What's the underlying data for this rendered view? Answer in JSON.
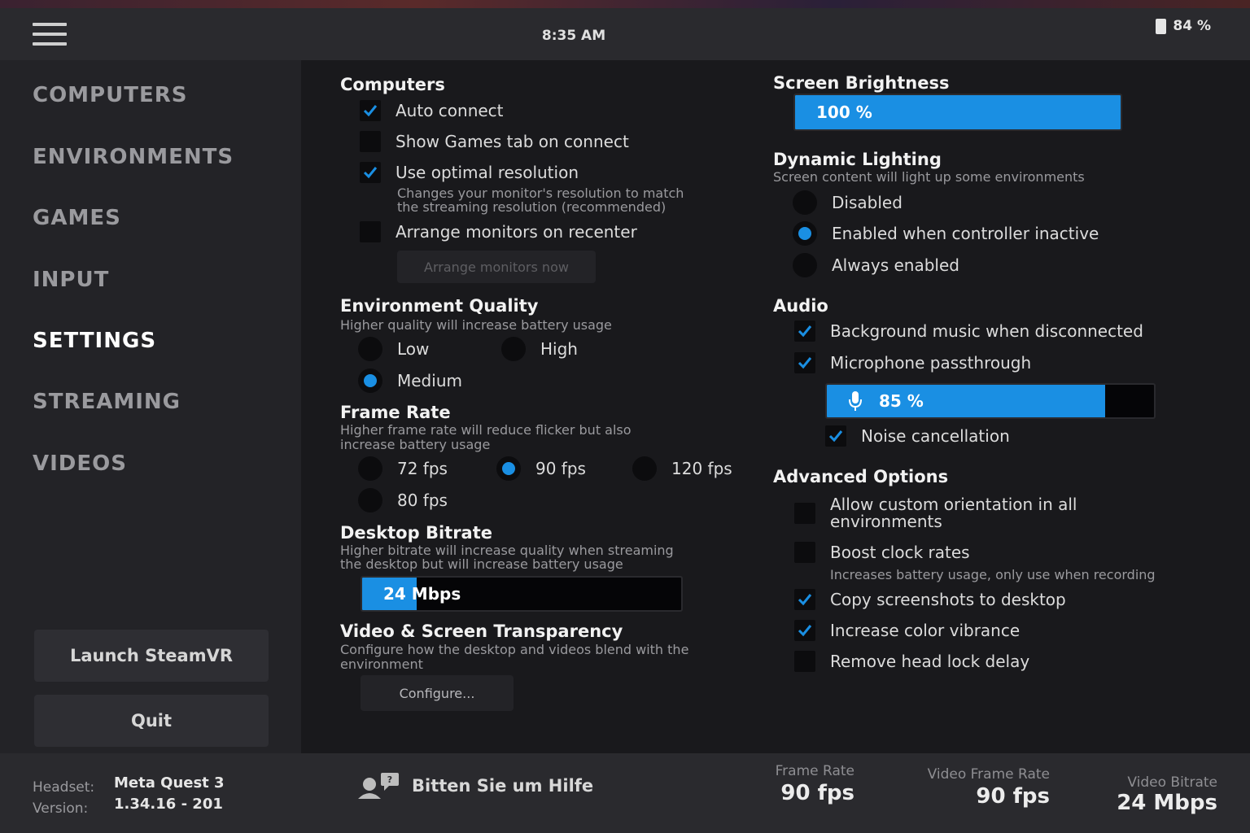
{
  "topbar": {
    "time": "8:35 AM",
    "battery": "84 %"
  },
  "sidebar": {
    "items": [
      "COMPUTERS",
      "ENVIRONMENTS",
      "GAMES",
      "INPUT",
      "SETTINGS",
      "STREAMING",
      "VIDEOS"
    ],
    "active": "SETTINGS",
    "launch_label": "Launch SteamVR",
    "quit_label": "Quit"
  },
  "computers": {
    "title": "Computers",
    "auto_connect": "Auto connect",
    "show_games": "Show Games tab on connect",
    "optimal_resolution": "Use optimal resolution",
    "optimal_desc_1": "Changes your monitor's resolution to match",
    "optimal_desc_2": "the streaming resolution (recommended)",
    "arrange_recenter": "Arrange monitors on recenter",
    "arrange_now": "Arrange monitors now"
  },
  "environment_quality": {
    "title": "Environment Quality",
    "desc": "Higher quality will increase battery usage",
    "low": "Low",
    "high": "High",
    "medium": "Medium",
    "selected": "Medium"
  },
  "frame_rate": {
    "title": "Frame Rate",
    "desc_1": "Higher frame rate will reduce flicker but also",
    "desc_2": "increase battery usage",
    "fps72": "72 fps",
    "fps90": "90 fps",
    "fps120": "120 fps",
    "fps80": "80 fps",
    "selected": "90 fps"
  },
  "desktop_bitrate": {
    "title": "Desktop Bitrate",
    "desc_1": "Higher bitrate will increase quality when streaming",
    "desc_2": "the desktop but will increase battery usage",
    "value": "24 Mbps",
    "fill_fraction": 0.17
  },
  "transparency": {
    "title": "Video & Screen Transparency",
    "desc_1": "Configure how the desktop and videos blend with the",
    "desc_2": "environment",
    "configure": "Configure..."
  },
  "brightness": {
    "title": "Screen Brightness",
    "value": "100 %",
    "fill_fraction": 1.0
  },
  "dynamic_lighting": {
    "title": "Dynamic Lighting",
    "desc": "Screen content will light up some environments",
    "disabled": "Disabled",
    "inactive": "Enabled when controller inactive",
    "always": "Always enabled",
    "selected": "Enabled when controller inactive"
  },
  "audio": {
    "title": "Audio",
    "bg_music": "Background music when disconnected",
    "mic": "Microphone passthrough",
    "mic_level": "85 %",
    "mic_fill_fraction": 0.85,
    "noise": "Noise cancellation"
  },
  "advanced": {
    "title": "Advanced Options",
    "custom_orientation_1": "Allow custom orientation in all",
    "custom_orientation_2": "environments",
    "boost": "Boost clock rates",
    "boost_desc": "Increases battery usage, only use when recording",
    "screenshots": "Copy screenshots to desktop",
    "vibrance": "Increase color vibrance",
    "head_lock": "Remove head lock delay"
  },
  "footer": {
    "headset_label": "Headset:",
    "headset_value": "Meta Quest 3",
    "version_label": "Version:",
    "version_value": "1.34.16 - 201",
    "help": "Bitten Sie um Hilfe",
    "frame_rate_label": "Frame Rate",
    "frame_rate_value": "90 fps",
    "video_frame_rate_label": "Video Frame Rate",
    "video_frame_rate_value": "90 fps",
    "video_bitrate_label": "Video Bitrate",
    "video_bitrate_value": "24 Mbps"
  },
  "colors": {
    "accent": "#1a8fe3",
    "background": "#19191c",
    "panel": "#2a2a2e"
  }
}
